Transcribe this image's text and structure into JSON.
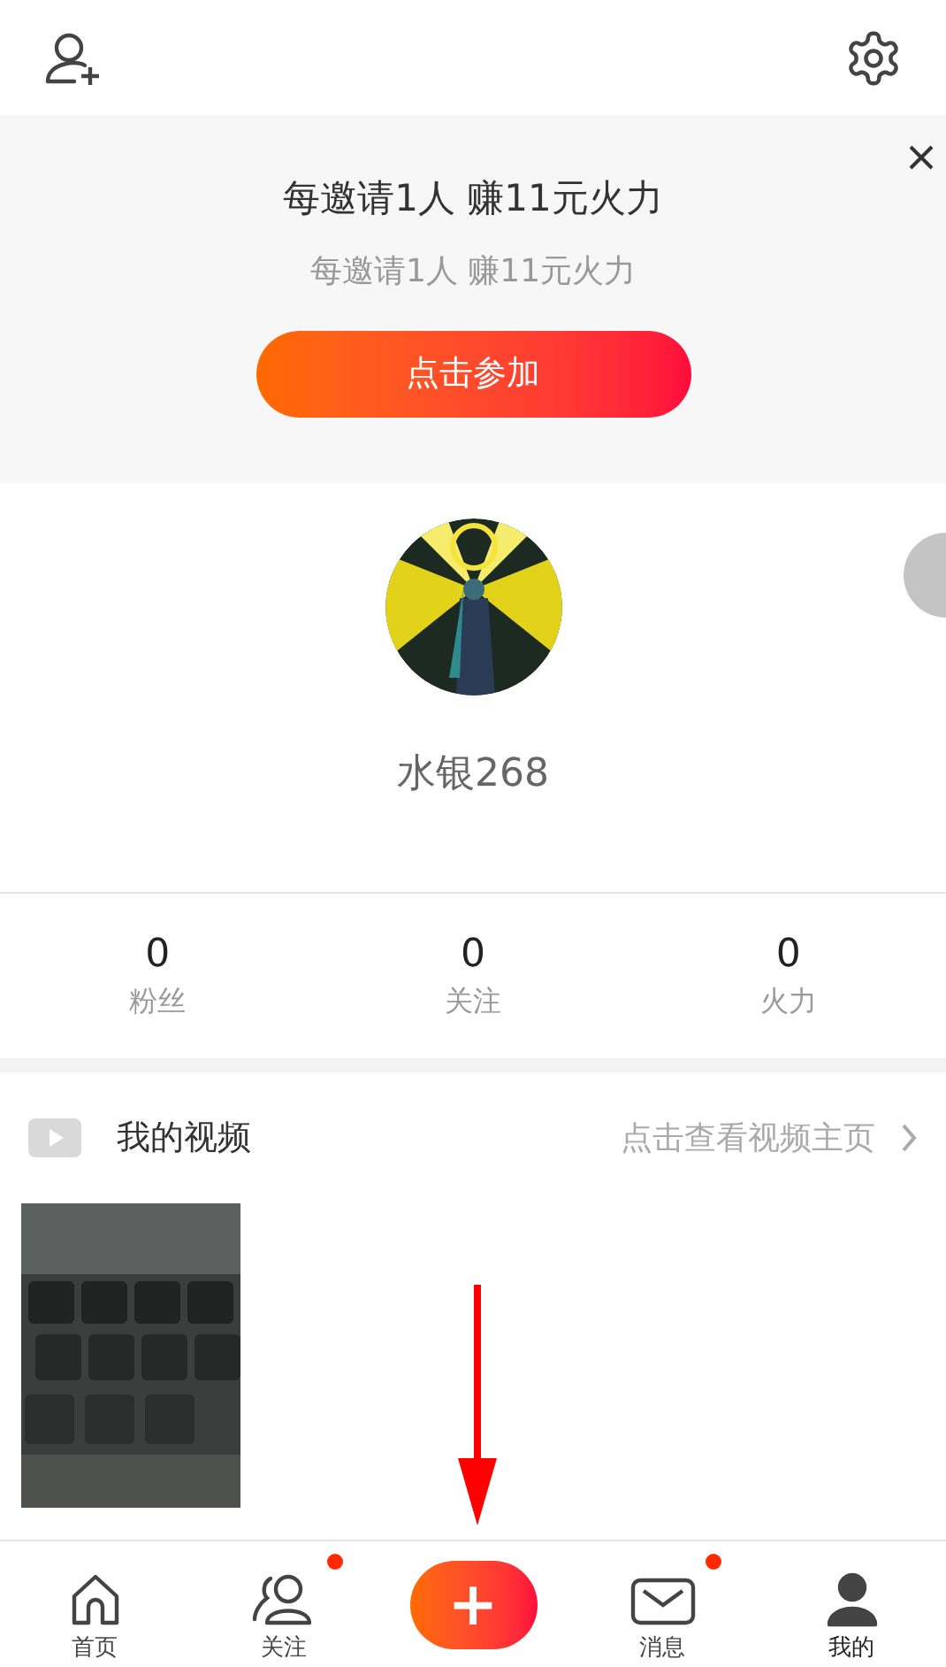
{
  "banner": {
    "title": "每邀请1人 赚11元火力",
    "subtitle": "每邀请1人 赚11元火力",
    "button": "点击参加"
  },
  "profile": {
    "username": "水银268"
  },
  "stats": [
    {
      "value": "0",
      "label": "粉丝"
    },
    {
      "value": "0",
      "label": "关注"
    },
    {
      "value": "0",
      "label": "火力"
    }
  ],
  "videos": {
    "title": "我的视频",
    "link": "点击查看视频主页"
  },
  "nav": [
    {
      "kind": "tab",
      "label": "首页",
      "selected": false,
      "badge": false
    },
    {
      "kind": "tab",
      "label": "关注",
      "selected": false,
      "badge": true
    },
    {
      "kind": "create",
      "label": "+"
    },
    {
      "kind": "tab",
      "label": "消息",
      "selected": false,
      "badge": true
    },
    {
      "kind": "tab",
      "label": "我的",
      "selected": true,
      "badge": false
    }
  ]
}
